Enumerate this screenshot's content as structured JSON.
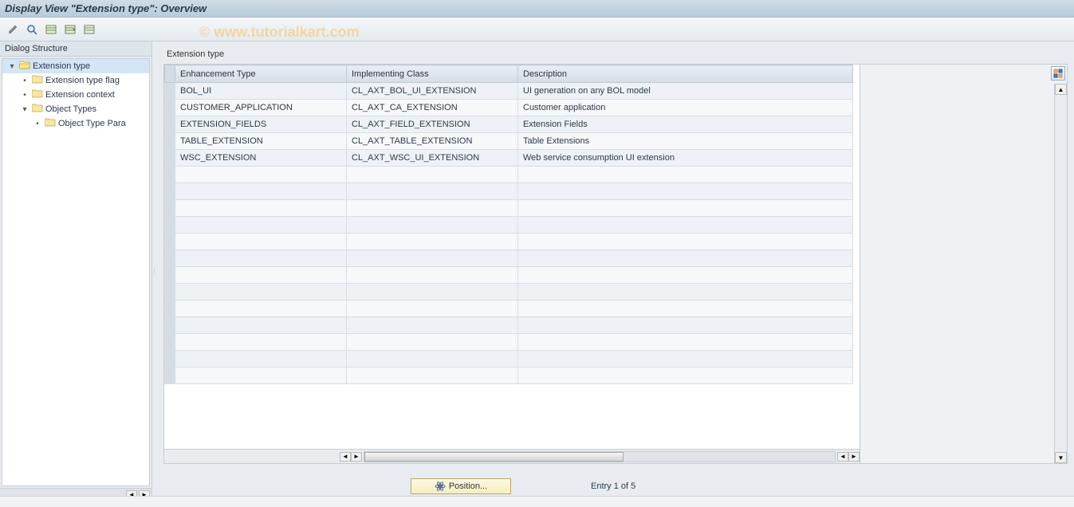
{
  "title": "Display View \"Extension type\": Overview",
  "watermark": "© www.tutorialkart.com",
  "sidebar": {
    "header": "Dialog Structure",
    "items": [
      {
        "label": "Extension type",
        "indent": 0,
        "expanded": true,
        "open": true,
        "selected": true
      },
      {
        "label": "Extension type flag",
        "indent": 1,
        "expanded": null,
        "open": false
      },
      {
        "label": "Extension context",
        "indent": 1,
        "expanded": null,
        "open": false
      },
      {
        "label": "Object Types",
        "indent": 1,
        "expanded": true,
        "open": false
      },
      {
        "label": "Object Type Para",
        "indent": 2,
        "expanded": null,
        "open": false
      }
    ]
  },
  "panel": {
    "title": "Extension type",
    "columns": [
      "Enhancement Type",
      "Implementing Class",
      "Description"
    ],
    "rows": [
      {
        "c0": "BOL_UI",
        "c1": "CL_AXT_BOL_UI_EXTENSION",
        "c2": "UI generation on any BOL model"
      },
      {
        "c0": "CUSTOMER_APPLICATION",
        "c1": "CL_AXT_CA_EXTENSION",
        "c2": "Customer application"
      },
      {
        "c0": "EXTENSION_FIELDS",
        "c1": "CL_AXT_FIELD_EXTENSION",
        "c2": "Extension Fields"
      },
      {
        "c0": "TABLE_EXTENSION",
        "c1": "CL_AXT_TABLE_EXTENSION",
        "c2": "Table Extensions"
      },
      {
        "c0": "WSC_EXTENSION",
        "c1": "CL_AXT_WSC_UI_EXTENSION",
        "c2": "Web service consumption UI extension"
      }
    ],
    "empty_rows": 13
  },
  "footer": {
    "position_label": "Position...",
    "entry_text": "Entry 1 of 5"
  }
}
